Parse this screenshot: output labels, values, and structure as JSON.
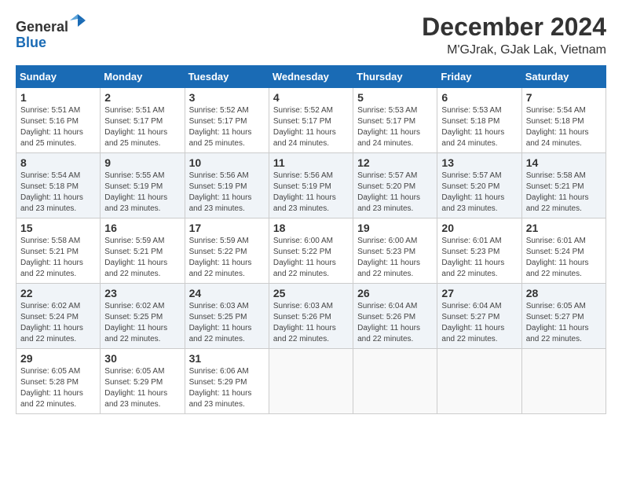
{
  "header": {
    "logo_general": "General",
    "logo_blue": "Blue",
    "title": "December 2024",
    "subtitle": "M'GJrak, GJak Lak, Vietnam"
  },
  "calendar": {
    "days_of_week": [
      "Sunday",
      "Monday",
      "Tuesday",
      "Wednesday",
      "Thursday",
      "Friday",
      "Saturday"
    ],
    "weeks": [
      [
        {
          "day": "1",
          "info": "Sunrise: 5:51 AM\nSunset: 5:16 PM\nDaylight: 11 hours\nand 25 minutes."
        },
        {
          "day": "2",
          "info": "Sunrise: 5:51 AM\nSunset: 5:17 PM\nDaylight: 11 hours\nand 25 minutes."
        },
        {
          "day": "3",
          "info": "Sunrise: 5:52 AM\nSunset: 5:17 PM\nDaylight: 11 hours\nand 25 minutes."
        },
        {
          "day": "4",
          "info": "Sunrise: 5:52 AM\nSunset: 5:17 PM\nDaylight: 11 hours\nand 24 minutes."
        },
        {
          "day": "5",
          "info": "Sunrise: 5:53 AM\nSunset: 5:17 PM\nDaylight: 11 hours\nand 24 minutes."
        },
        {
          "day": "6",
          "info": "Sunrise: 5:53 AM\nSunset: 5:18 PM\nDaylight: 11 hours\nand 24 minutes."
        },
        {
          "day": "7",
          "info": "Sunrise: 5:54 AM\nSunset: 5:18 PM\nDaylight: 11 hours\nand 24 minutes."
        }
      ],
      [
        {
          "day": "8",
          "info": "Sunrise: 5:54 AM\nSunset: 5:18 PM\nDaylight: 11 hours\nand 23 minutes."
        },
        {
          "day": "9",
          "info": "Sunrise: 5:55 AM\nSunset: 5:19 PM\nDaylight: 11 hours\nand 23 minutes."
        },
        {
          "day": "10",
          "info": "Sunrise: 5:56 AM\nSunset: 5:19 PM\nDaylight: 11 hours\nand 23 minutes."
        },
        {
          "day": "11",
          "info": "Sunrise: 5:56 AM\nSunset: 5:19 PM\nDaylight: 11 hours\nand 23 minutes."
        },
        {
          "day": "12",
          "info": "Sunrise: 5:57 AM\nSunset: 5:20 PM\nDaylight: 11 hours\nand 23 minutes."
        },
        {
          "day": "13",
          "info": "Sunrise: 5:57 AM\nSunset: 5:20 PM\nDaylight: 11 hours\nand 23 minutes."
        },
        {
          "day": "14",
          "info": "Sunrise: 5:58 AM\nSunset: 5:21 PM\nDaylight: 11 hours\nand 22 minutes."
        }
      ],
      [
        {
          "day": "15",
          "info": "Sunrise: 5:58 AM\nSunset: 5:21 PM\nDaylight: 11 hours\nand 22 minutes."
        },
        {
          "day": "16",
          "info": "Sunrise: 5:59 AM\nSunset: 5:21 PM\nDaylight: 11 hours\nand 22 minutes."
        },
        {
          "day": "17",
          "info": "Sunrise: 5:59 AM\nSunset: 5:22 PM\nDaylight: 11 hours\nand 22 minutes."
        },
        {
          "day": "18",
          "info": "Sunrise: 6:00 AM\nSunset: 5:22 PM\nDaylight: 11 hours\nand 22 minutes."
        },
        {
          "day": "19",
          "info": "Sunrise: 6:00 AM\nSunset: 5:23 PM\nDaylight: 11 hours\nand 22 minutes."
        },
        {
          "day": "20",
          "info": "Sunrise: 6:01 AM\nSunset: 5:23 PM\nDaylight: 11 hours\nand 22 minutes."
        },
        {
          "day": "21",
          "info": "Sunrise: 6:01 AM\nSunset: 5:24 PM\nDaylight: 11 hours\nand 22 minutes."
        }
      ],
      [
        {
          "day": "22",
          "info": "Sunrise: 6:02 AM\nSunset: 5:24 PM\nDaylight: 11 hours\nand 22 minutes."
        },
        {
          "day": "23",
          "info": "Sunrise: 6:02 AM\nSunset: 5:25 PM\nDaylight: 11 hours\nand 22 minutes."
        },
        {
          "day": "24",
          "info": "Sunrise: 6:03 AM\nSunset: 5:25 PM\nDaylight: 11 hours\nand 22 minutes."
        },
        {
          "day": "25",
          "info": "Sunrise: 6:03 AM\nSunset: 5:26 PM\nDaylight: 11 hours\nand 22 minutes."
        },
        {
          "day": "26",
          "info": "Sunrise: 6:04 AM\nSunset: 5:26 PM\nDaylight: 11 hours\nand 22 minutes."
        },
        {
          "day": "27",
          "info": "Sunrise: 6:04 AM\nSunset: 5:27 PM\nDaylight: 11 hours\nand 22 minutes."
        },
        {
          "day": "28",
          "info": "Sunrise: 6:05 AM\nSunset: 5:27 PM\nDaylight: 11 hours\nand 22 minutes."
        }
      ],
      [
        {
          "day": "29",
          "info": "Sunrise: 6:05 AM\nSunset: 5:28 PM\nDaylight: 11 hours\nand 22 minutes."
        },
        {
          "day": "30",
          "info": "Sunrise: 6:05 AM\nSunset: 5:29 PM\nDaylight: 11 hours\nand 23 minutes."
        },
        {
          "day": "31",
          "info": "Sunrise: 6:06 AM\nSunset: 5:29 PM\nDaylight: 11 hours\nand 23 minutes."
        },
        {
          "day": "",
          "info": ""
        },
        {
          "day": "",
          "info": ""
        },
        {
          "day": "",
          "info": ""
        },
        {
          "day": "",
          "info": ""
        }
      ]
    ]
  }
}
